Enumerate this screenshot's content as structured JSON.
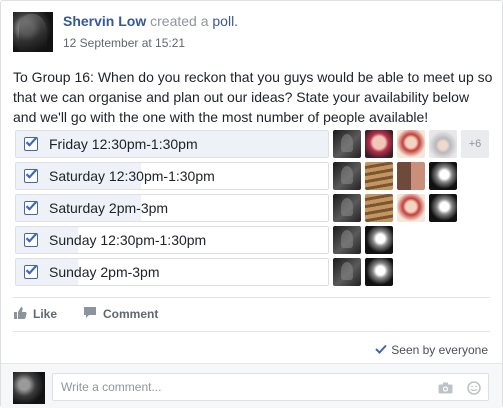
{
  "post": {
    "author": "Shervin Low",
    "action_text": "created a",
    "action_link": "poll.",
    "timestamp": "12 September at 15:21",
    "text": "To Group 16: When do you reckon that you guys would be able to meet up so that we can organise and plan out our ideas? State your availability below and we'll go with the one with the most number of people available!"
  },
  "poll": {
    "options": [
      {
        "label": "Friday 12:30pm-1:30pm",
        "checked": true,
        "share": 1.0,
        "voters": [
          "dark",
          "pink",
          "girl",
          "hijab"
        ],
        "more": "+6"
      },
      {
        "label": "Saturday 12:30pm-1:30pm",
        "checked": true,
        "share": 0.4,
        "voters": [
          "dark",
          "stairs",
          "faces",
          "bw"
        ],
        "more": ""
      },
      {
        "label": "Saturday 2pm-3pm",
        "checked": true,
        "share": 0.4,
        "voters": [
          "dark",
          "stairs",
          "girl",
          "bw"
        ],
        "more": ""
      },
      {
        "label": "Sunday 12:30pm-1:30pm",
        "checked": true,
        "share": 0.2,
        "voters": [
          "dark",
          "bw"
        ],
        "more": ""
      },
      {
        "label": "Sunday 2pm-3pm",
        "checked": true,
        "share": 0.2,
        "voters": [
          "dark",
          "bw"
        ],
        "more": ""
      }
    ]
  },
  "actions": {
    "like_label": "Like",
    "comment_label": "Comment",
    "seen_label": "Seen by everyone"
  },
  "comment_box": {
    "placeholder": "Write a comment..."
  },
  "icons": {
    "like": "thumbs-up-icon",
    "comment": "speech-bubble-icon",
    "seen": "checkmark-icon",
    "camera": "camera-icon",
    "emoji": "smiley-icon"
  },
  "colors": {
    "link": "#365899",
    "checkbox": "#4267b2",
    "bar_fill": "#eef1f7"
  }
}
